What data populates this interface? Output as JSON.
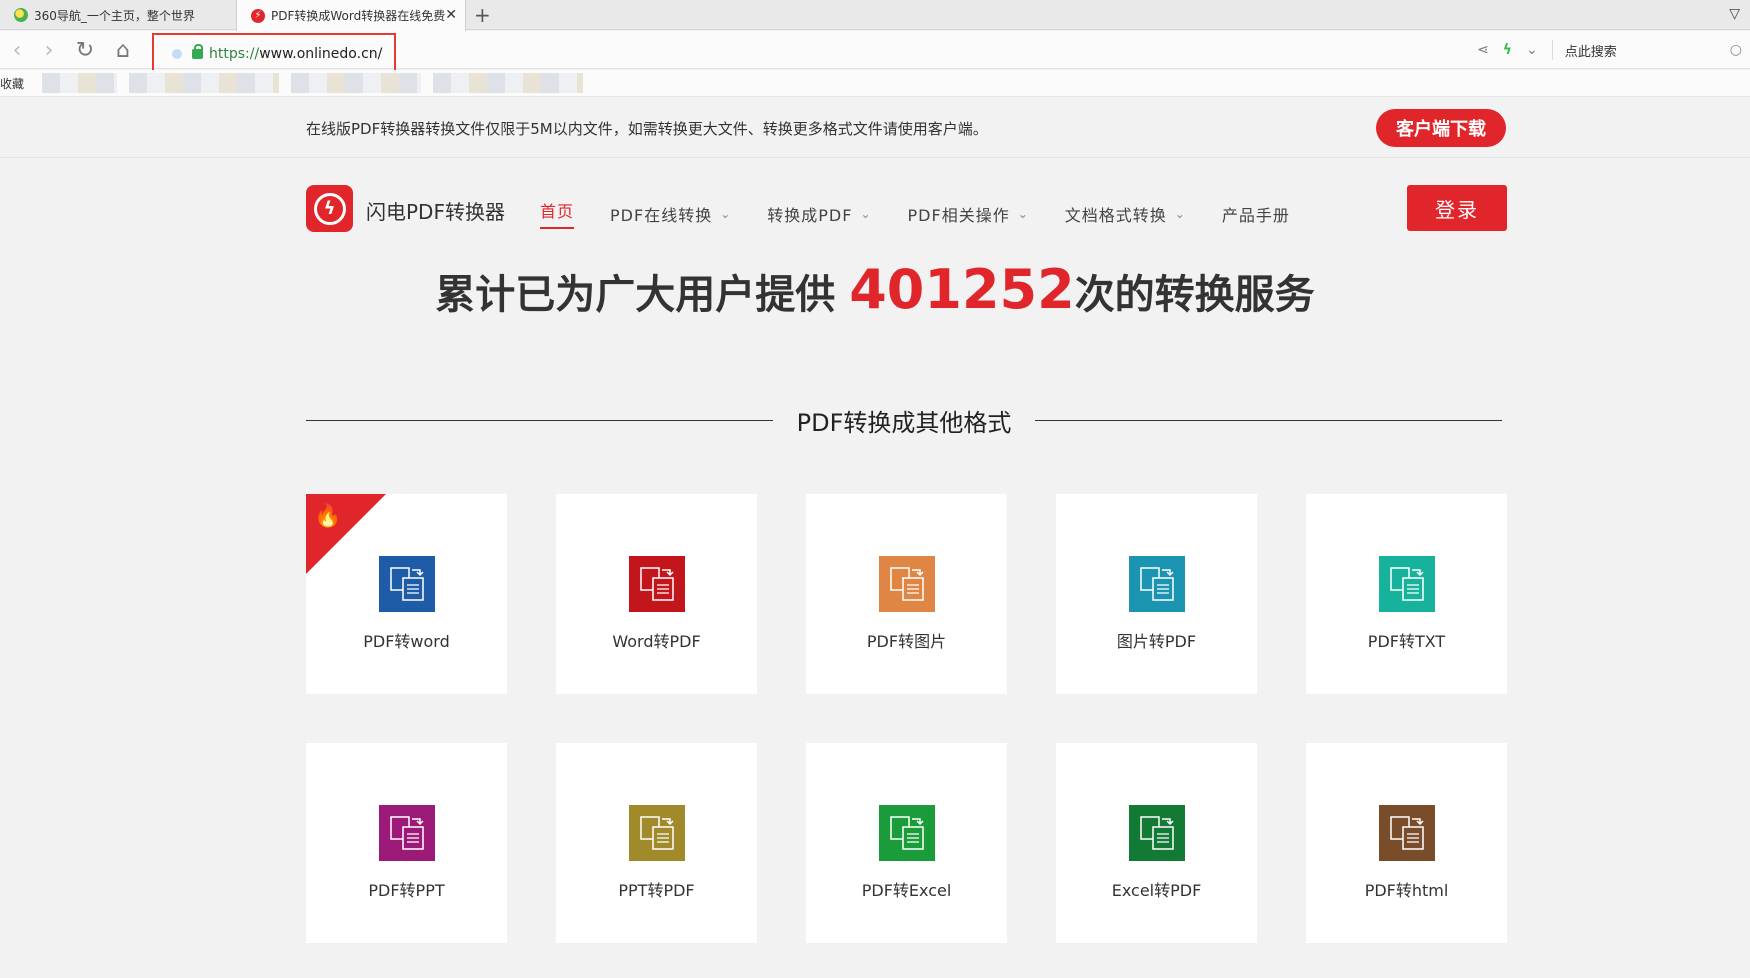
{
  "browser": {
    "tabs": [
      {
        "title": "360导航_一个主页，整个世界"
      },
      {
        "title": "PDF转换成Word转换器在线免费"
      }
    ],
    "url_scheme": "https://",
    "url_host": "www.onlinedo.cn/",
    "search_placeholder": "点此搜索",
    "bookmarks_label": "收藏"
  },
  "notice": {
    "text": "在线版PDF转换器转换文件仅限于5M以内文件，如需转换更大文件、转换更多格式文件请使用客户端。",
    "download_label": "客户端下载"
  },
  "header": {
    "logo_text": "闪电PDF转换器",
    "nav": [
      {
        "label": "首页",
        "dropdown": false
      },
      {
        "label": "PDF在线转换",
        "dropdown": true
      },
      {
        "label": "转换成PDF",
        "dropdown": true
      },
      {
        "label": "PDF相关操作",
        "dropdown": true
      },
      {
        "label": "文档格式转换",
        "dropdown": true
      },
      {
        "label": "产品手册",
        "dropdown": false
      }
    ],
    "login_label": "登录"
  },
  "stats": {
    "prefix": "累计已为广大用户提供 ",
    "count": "401252",
    "suffix": "次的转换服务"
  },
  "section": {
    "title": "PDF转换成其他格式"
  },
  "tools": [
    {
      "label": "PDF转word",
      "color": "#1f5ca8",
      "icon": "pdf-to-word-icon",
      "hot": true
    },
    {
      "label": "Word转PDF",
      "color": "#c3161c",
      "icon": "word-to-pdf-icon",
      "hot": false
    },
    {
      "label": "PDF转图片",
      "color": "#e08645",
      "icon": "pdf-to-image-icon",
      "hot": false
    },
    {
      "label": "图片转PDF",
      "color": "#1a94b0",
      "icon": "image-to-pdf-icon",
      "hot": false
    },
    {
      "label": "PDF转TXT",
      "color": "#17b29b",
      "icon": "pdf-to-txt-icon",
      "hot": false
    },
    {
      "label": "PDF转PPT",
      "color": "#9b1a78",
      "icon": "pdf-to-ppt-icon",
      "hot": false
    },
    {
      "label": "PPT转PDF",
      "color": "#a08a2a",
      "icon": "ppt-to-pdf-icon",
      "hot": false
    },
    {
      "label": "PDF转Excel",
      "color": "#1a9c3a",
      "icon": "pdf-to-excel-icon",
      "hot": false
    },
    {
      "label": "Excel转PDF",
      "color": "#137a35",
      "icon": "excel-to-pdf-icon",
      "hot": false
    },
    {
      "label": "PDF转html",
      "color": "#7a4d2a",
      "icon": "pdf-to-html-icon",
      "hot": false
    }
  ]
}
